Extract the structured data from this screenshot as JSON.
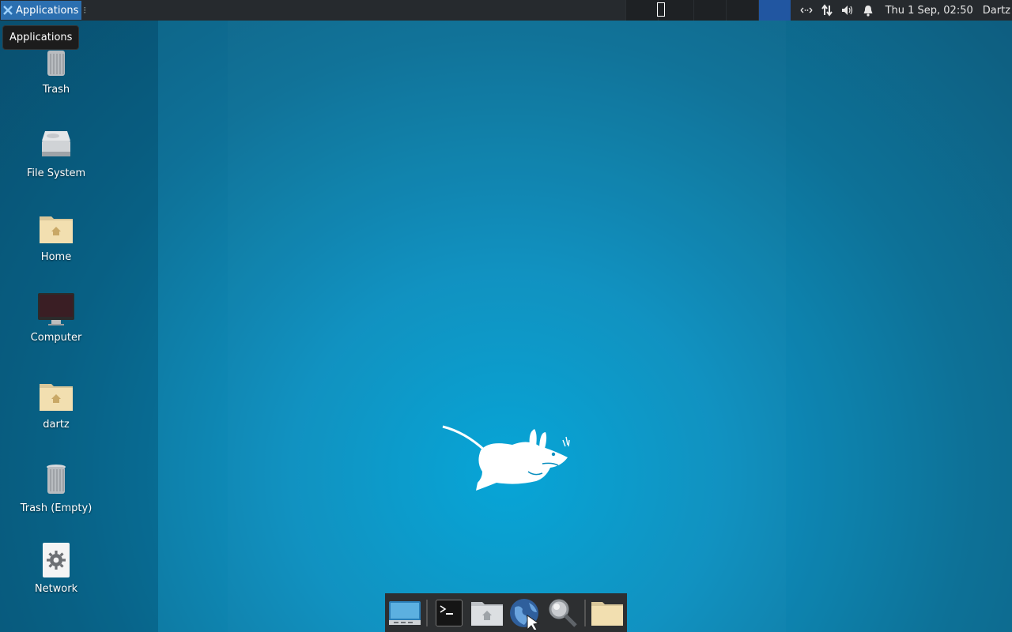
{
  "top_panel": {
    "applications_label": "Applications",
    "tray_icons": [
      "network-arrows-icon",
      "updown-arrows-icon",
      "volume-icon",
      "bell-icon"
    ],
    "clock": "Thu  1 Sep, 02:50",
    "user": "Dartz"
  },
  "tooltip": {
    "text": "Applications"
  },
  "desktop_icons": [
    {
      "label": "Trash",
      "icon": "trash-icon"
    },
    {
      "label": "File System",
      "icon": "drive-icon"
    },
    {
      "label": "Home",
      "icon": "home-folder-icon"
    },
    {
      "label": "Computer",
      "icon": "computer-icon"
    },
    {
      "label": "dartz",
      "icon": "home-folder-icon"
    },
    {
      "label": "Trash (Empty)",
      "icon": "trash-icon"
    },
    {
      "label": "Network",
      "icon": "network-gear-icon"
    }
  ],
  "dock": [
    "show-desktop-icon",
    "terminal-icon",
    "home-folder-icon",
    "web-browser-icon",
    "search-icon",
    "folder-icon"
  ],
  "colors": {
    "panel": "#262a2e",
    "accent": "#2b6fb0",
    "desktop": "#0a8fbf"
  }
}
